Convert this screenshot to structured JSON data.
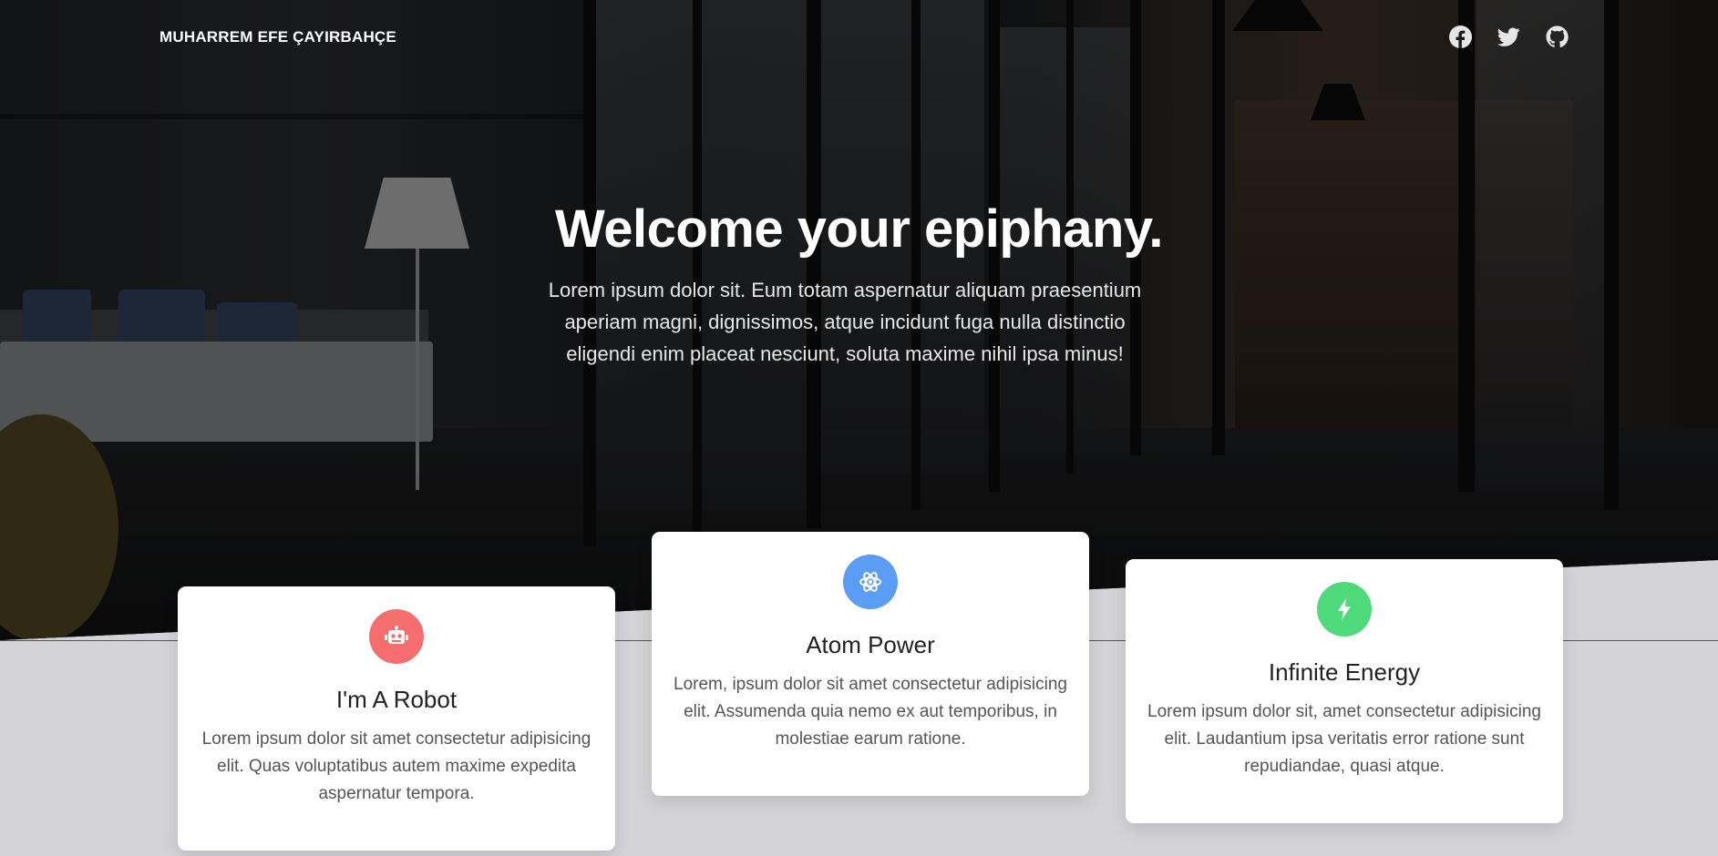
{
  "nav": {
    "brand": "MUHARREM EFE ÇAYIRBAHÇE",
    "icons": [
      "facebook-icon",
      "twitter-icon",
      "github-icon"
    ]
  },
  "hero": {
    "title": "Welcome your epiphany.",
    "text": "Lorem ipsum dolor sit. Eum totam aspernatur aliquam praesentium aperiam magni, dignissimos, atque incidunt fuga nulla distinctio eligendi enim placeat nesciunt, soluta maxime nihil ipsa minus!"
  },
  "cards": [
    {
      "icon": "robot-icon",
      "color": "#f56e6e",
      "title": "I'm A Robot",
      "text": "Lorem ipsum dolor sit amet consectetur adipisicing elit. Quas voluptatibus autem maxime expedita aspernatur tempora."
    },
    {
      "icon": "atom-icon",
      "color": "#5b9cf5",
      "title": "Atom Power",
      "text": "Lorem, ipsum dolor sit amet consectetur adipisicing elit. Assumenda quia nemo ex aut temporibus, in molestiae earum ratione."
    },
    {
      "icon": "bolt-icon",
      "color": "#4ed97a",
      "title": "Infinite Energy",
      "text": "Lorem ipsum dolor sit, amet consectetur adipisicing elit. Laudantium ipsa veritatis error ratione sunt repudiandae, quasi atque."
    }
  ]
}
